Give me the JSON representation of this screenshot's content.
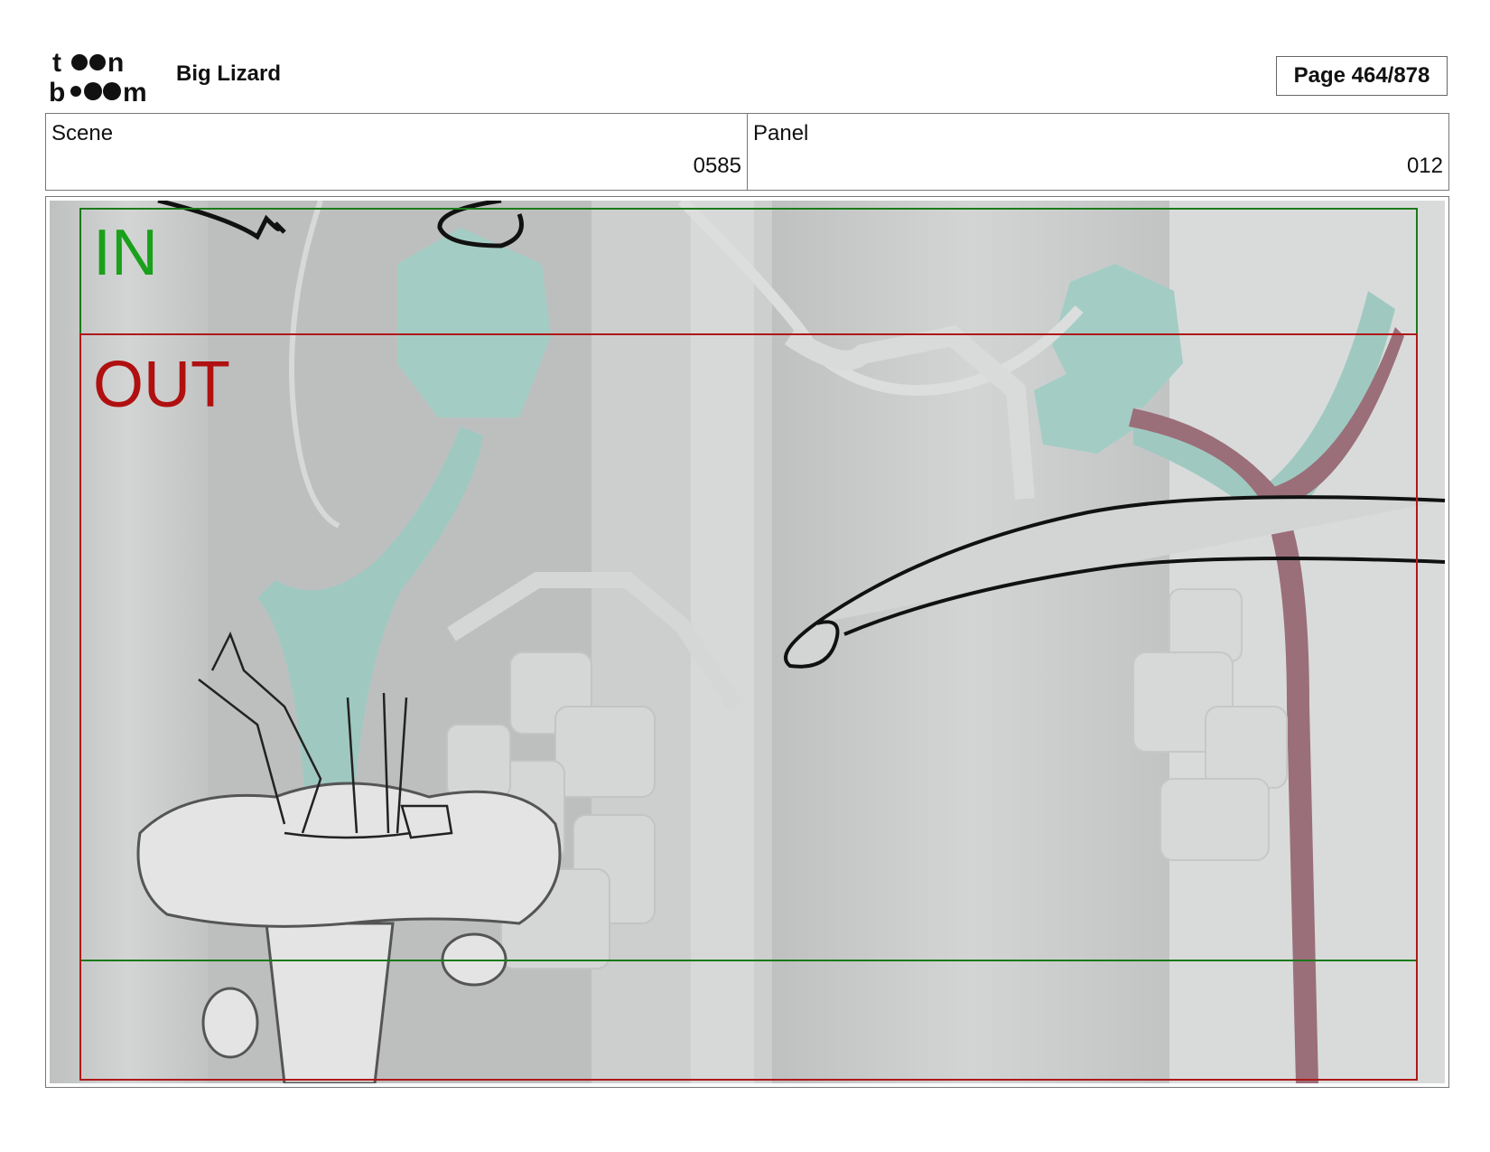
{
  "header": {
    "logo_icon": "toon-boom-logo",
    "project_title": "Big Lizard",
    "page_label": "Page 464/878"
  },
  "info": {
    "scene_label": "Scene",
    "scene_value": "0585",
    "panel_label": "Panel",
    "panel_value": "012"
  },
  "panel": {
    "in_label": "IN",
    "out_label": "OUT",
    "colors": {
      "in_frame": "#1a7a1a",
      "out_frame": "#b01818",
      "background": "#c9cbcb",
      "foliage": "#9fc9c0",
      "vine": "#9a6f79"
    }
  }
}
